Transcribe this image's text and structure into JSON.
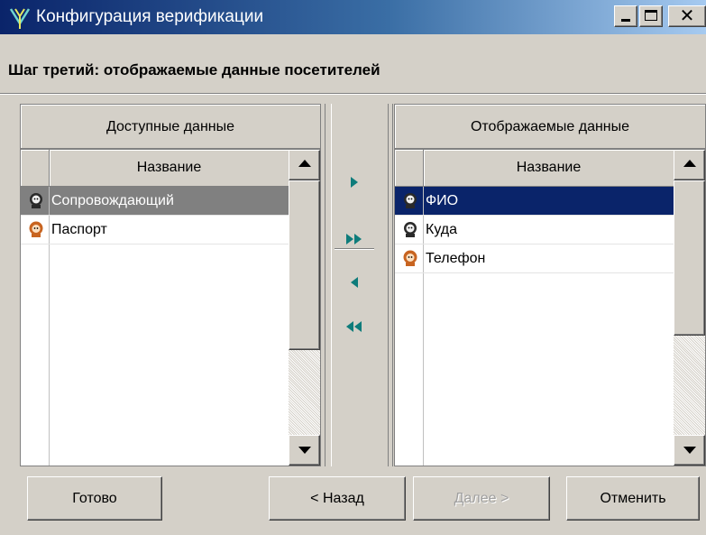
{
  "window": {
    "title": "Конфигурация верификации",
    "close_glyph": "✕"
  },
  "step_title": "Шаг третий: отображаемые данные посетителей",
  "left_panel": {
    "header": "Доступные данные",
    "column": "Название",
    "rows": [
      {
        "label": "Сопровождающий",
        "icon": "male-person-icon",
        "selected": true
      },
      {
        "label": "Паспорт",
        "icon": "female-person-icon",
        "selected": false
      }
    ]
  },
  "right_panel": {
    "header": "Отображаемые данные",
    "column": "Название",
    "rows": [
      {
        "label": "ФИО",
        "icon": "male-person-icon",
        "selected": true
      },
      {
        "label": "Куда",
        "icon": "male-person-icon",
        "selected": false
      },
      {
        "label": "Телефон",
        "icon": "female-person-icon",
        "selected": false
      }
    ]
  },
  "move_buttons": [
    "move-right-icon",
    "move-all-right-icon",
    "move-left-icon",
    "move-all-left-icon"
  ],
  "buttons": {
    "done": "Готово",
    "back": "< Назад",
    "next": "Далее >",
    "cancel": "Отменить"
  },
  "colors": {
    "title_gradient_start": "#0a246a",
    "selection_navy": "#0a246a",
    "selection_gray": "#808080",
    "arrow_teal": "#0e7c7b"
  }
}
